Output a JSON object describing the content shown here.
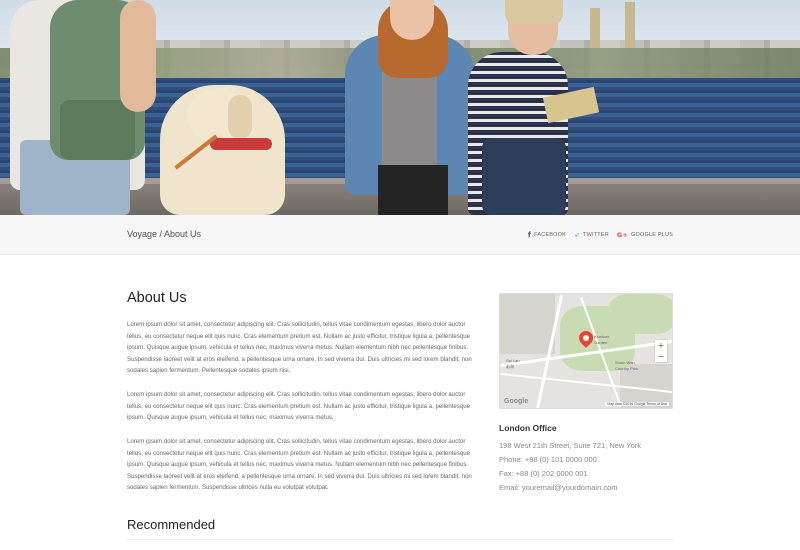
{
  "breadcrumb": "Voyage / About Us",
  "social": [
    {
      "icon": "facebook-icon",
      "label": "FACEBOOK"
    },
    {
      "icon": "twitter-icon",
      "label": "TWITTER"
    },
    {
      "icon": "google-plus-icon",
      "label": "GOOGLE PLUS"
    }
  ],
  "main": {
    "title": "About Us",
    "paragraphs": [
      "Lorem ipsum dolor sit amet, consectetur adipiscing elit. Cras sollicitudin, tellus vitae condimentum egestas, libero dolor auctor tellus, eu consectetur neque elit quis nunc. Cras elementum pretium est. Nullam ac justo efficitur, tristique ligula a, pellentesque ipsum. Quisque augue ipsum, vehicula et tellus nec, maximus viverra metus. Nullam elementum nibh nec pellentesque finibus. Suspendisse laoreet velit at eros eleifend, a pellentesque urna ornare. In sed viverra dui. Duis ultricies mi sed lorem blandit, non sodales sapien fermentum. Pellentesque sodales ipsum nisi.",
      "Lorem ipsum dolor sit amet, consectetur adipiscing elit. Cras sollicitudin, tellus vitae condimentum egestas, libero dolor auctor tellus, eu consectetur neque elit quis nunc. Cras elementum pretium est. Nullam ac justo efficitur, tristique ligula a, pellentesque ipsum. Quisque augue ipsum, vehicula et tellus nec, maximus viverra metus.",
      "Lorem ipsum dolor sit amet, consectetur adipiscing elit. Cras sollicitudin, tellus vitae condimentum egestas, libero dolor auctor tellus, eu consectetur neque elit quis nunc. Cras elementum pretium est. Nullam ac justo efficitur, tristique ligula a, pellentesque ipsum. Quisque augue ipsum, vehicula et tellus nec, maximus viverra metus. Nullam elementum nibh nec pellentesque finibus. Suspendisse laoreet velit at eros eleifend, a pellentesque urna ornare. In sed viverra dui. Duis ultricies mi sed lorem blandit, non sodales sapien fermentum. Suspendisse ultrices nulla eu volutpat volutpat."
    ],
    "recommended_title": "Recommended"
  },
  "map": {
    "zoom_in": "+",
    "zoom_out": "−",
    "labels": [
      "Sai Lan",
      "Kowloon",
      "Garden",
      "Kowloon",
      "Park",
      "Sham Wan",
      "Country Park",
      "彩灣"
    ],
    "google": "Google",
    "attribution": "Map data ©2016 Google   Terms of Use"
  },
  "office": {
    "title": "London Office",
    "address": "198 West 21th Street, Suite 721, New York",
    "phone": "Phone: +88 (0) 101 0000 000",
    "fax": "Fax: +88 (0) 202 0000 001",
    "email": "Email: youremail@yourdomain.com"
  }
}
